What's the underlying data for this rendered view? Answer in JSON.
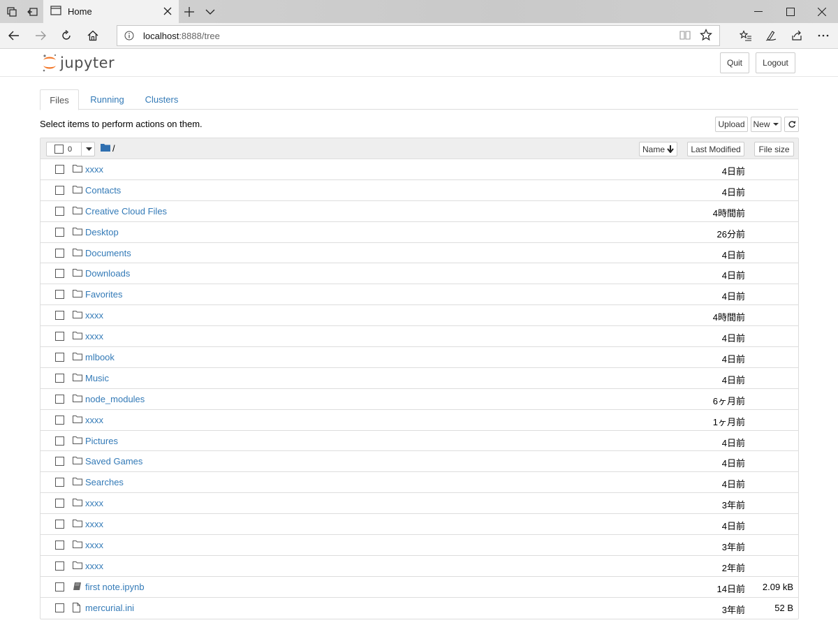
{
  "browser": {
    "tab_title": "Home",
    "url_host": "localhost",
    "url_path": ":8888/tree"
  },
  "header": {
    "logo_text": "jupyter",
    "quit_label": "Quit",
    "logout_label": "Logout"
  },
  "tabs": [
    {
      "label": "Files",
      "active": true
    },
    {
      "label": "Running",
      "active": false
    },
    {
      "label": "Clusters",
      "active": false
    }
  ],
  "toolbar": {
    "hint": "Select items to perform actions on them.",
    "upload_label": "Upload",
    "new_label": "New",
    "selected_count": "0",
    "breadcrumb_root": "/"
  },
  "columns": {
    "name": "Name",
    "last_modified": "Last Modified",
    "file_size": "File size"
  },
  "files": [
    {
      "name": "xxxx",
      "type": "folder",
      "modified": "4日前",
      "size": ""
    },
    {
      "name": "Contacts",
      "type": "folder",
      "modified": "4日前",
      "size": ""
    },
    {
      "name": "Creative Cloud Files",
      "type": "folder",
      "modified": "4時間前",
      "size": ""
    },
    {
      "name": "Desktop",
      "type": "folder",
      "modified": "26分前",
      "size": ""
    },
    {
      "name": "Documents",
      "type": "folder",
      "modified": "4日前",
      "size": ""
    },
    {
      "name": "Downloads",
      "type": "folder",
      "modified": "4日前",
      "size": ""
    },
    {
      "name": "Favorites",
      "type": "folder",
      "modified": "4日前",
      "size": ""
    },
    {
      "name": "xxxx",
      "type": "folder",
      "modified": "4時間前",
      "size": ""
    },
    {
      "name": "xxxx",
      "type": "folder",
      "modified": "4日前",
      "size": ""
    },
    {
      "name": "mlbook",
      "type": "folder",
      "modified": "4日前",
      "size": ""
    },
    {
      "name": "Music",
      "type": "folder",
      "modified": "4日前",
      "size": ""
    },
    {
      "name": "node_modules",
      "type": "folder",
      "modified": "6ヶ月前",
      "size": ""
    },
    {
      "name": "xxxx",
      "type": "folder",
      "modified": "1ヶ月前",
      "size": ""
    },
    {
      "name": "Pictures",
      "type": "folder",
      "modified": "4日前",
      "size": ""
    },
    {
      "name": "Saved Games",
      "type": "folder",
      "modified": "4日前",
      "size": ""
    },
    {
      "name": "Searches",
      "type": "folder",
      "modified": "4日前",
      "size": ""
    },
    {
      "name": "xxxx",
      "type": "folder",
      "modified": "3年前",
      "size": ""
    },
    {
      "name": "xxxx",
      "type": "folder",
      "modified": "4日前",
      "size": ""
    },
    {
      "name": "xxxx",
      "type": "folder",
      "modified": "3年前",
      "size": ""
    },
    {
      "name": "xxxx",
      "type": "folder",
      "modified": "2年前",
      "size": ""
    },
    {
      "name": "first note.ipynb",
      "type": "notebook",
      "modified": "14日前",
      "size": "2.09 kB"
    },
    {
      "name": "mercurial.ini",
      "type": "file",
      "modified": "3年前",
      "size": "52 B"
    }
  ],
  "colors": {
    "link": "#337ab7",
    "jupyter_orange": "#f37626"
  }
}
